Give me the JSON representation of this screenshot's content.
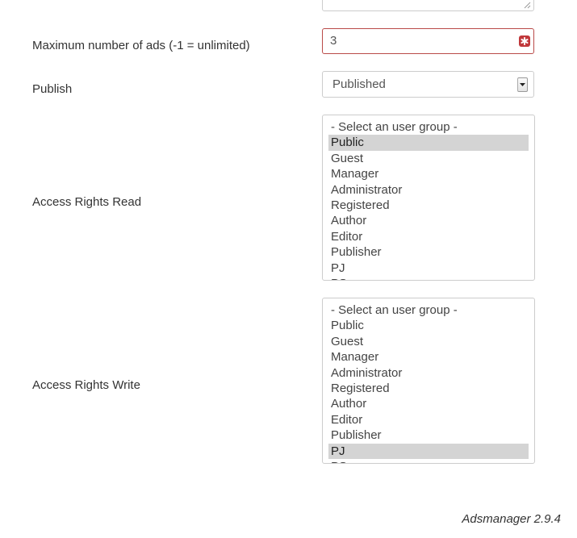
{
  "form": {
    "max_ads": {
      "label": "Maximum number of ads (-1 = unlimited)",
      "value": "3"
    },
    "publish": {
      "label": "Publish",
      "selected": "Published"
    },
    "access_read": {
      "label": "Access Rights Read",
      "options": [
        "- Select an user group -",
        "Public",
        "Guest",
        "Manager",
        "Administrator",
        "Registered",
        "Author",
        "Editor",
        "Publisher",
        "PJ",
        "PS"
      ],
      "selected_index": 1
    },
    "access_write": {
      "label": "Access Rights Write",
      "options": [
        "- Select an user group -",
        "Public",
        "Guest",
        "Manager",
        "Administrator",
        "Registered",
        "Author",
        "Editor",
        "Publisher",
        "PJ",
        "PS"
      ],
      "selected_index": 9
    }
  },
  "footer": {
    "version": "Adsmanager 2.9.4"
  },
  "colors": {
    "error_border": "#b94a48",
    "required_badge": "#c0383b",
    "selected_option": "#d4d4d4"
  },
  "icons": [
    "resize-grip-icon",
    "required-asterisk-icon",
    "dropdown-arrow-icon"
  ]
}
